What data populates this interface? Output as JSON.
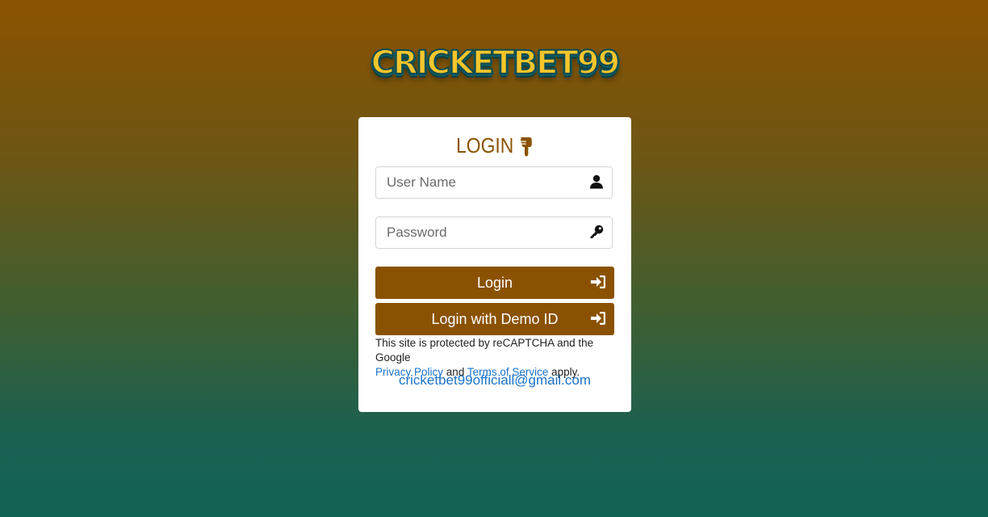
{
  "logo": {
    "text": "CRICKETBET99"
  },
  "login_card": {
    "title": "LOGIN",
    "username": {
      "placeholder": "User Name",
      "value": "",
      "icon": "user-icon"
    },
    "password": {
      "placeholder": "Password",
      "value": "",
      "icon": "key-icon"
    },
    "login_button": {
      "label": "Login",
      "icon": "sign-in-icon"
    },
    "demo_button": {
      "label": "Login with Demo ID",
      "icon": "sign-in-icon"
    },
    "recaptcha": {
      "prefix": "This site is protected by reCAPTCHA and the Google",
      "privacy_link": "Privacy Policy",
      "and_text": "and",
      "terms_link": "Terms of Service",
      "suffix": "apply."
    },
    "email": "cricketbet99officiall@gmail.com"
  },
  "colors": {
    "accent": "#8a5200",
    "link": "#1a73c8",
    "background_top": "#8a5200",
    "background_bottom": "#116354"
  }
}
